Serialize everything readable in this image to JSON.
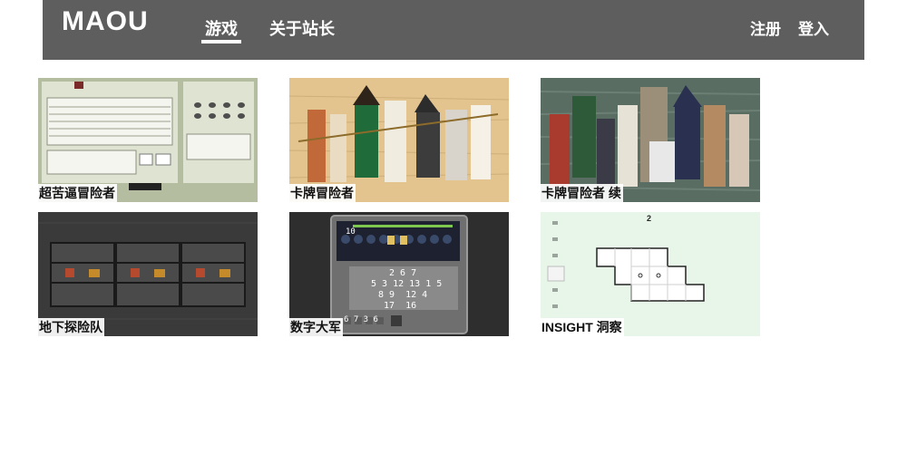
{
  "site": {
    "logo": "MAOU"
  },
  "nav": {
    "games": "游戏",
    "about": "关于站长",
    "register": "注册",
    "login": "登入"
  },
  "games": [
    {
      "title": "超苦逼冒险者"
    },
    {
      "title": "卡牌冒险者"
    },
    {
      "title": "卡牌冒险者 续"
    },
    {
      "title": "地下探险队"
    },
    {
      "title": "数字大军",
      "counter": "10",
      "row1": "2 6 7",
      "row2": "5 3 12 13 1 5",
      "row3": "8 9  12 4",
      "row4": "17  16",
      "bottom": "6 7 3 6"
    },
    {
      "title": "INSIGHT 洞察",
      "level": "2"
    }
  ],
  "colors": {
    "navbar": "#5e5e5e",
    "insight_bg": "#e8f6ea",
    "dungeon_bg": "#3a3a3a"
  }
}
